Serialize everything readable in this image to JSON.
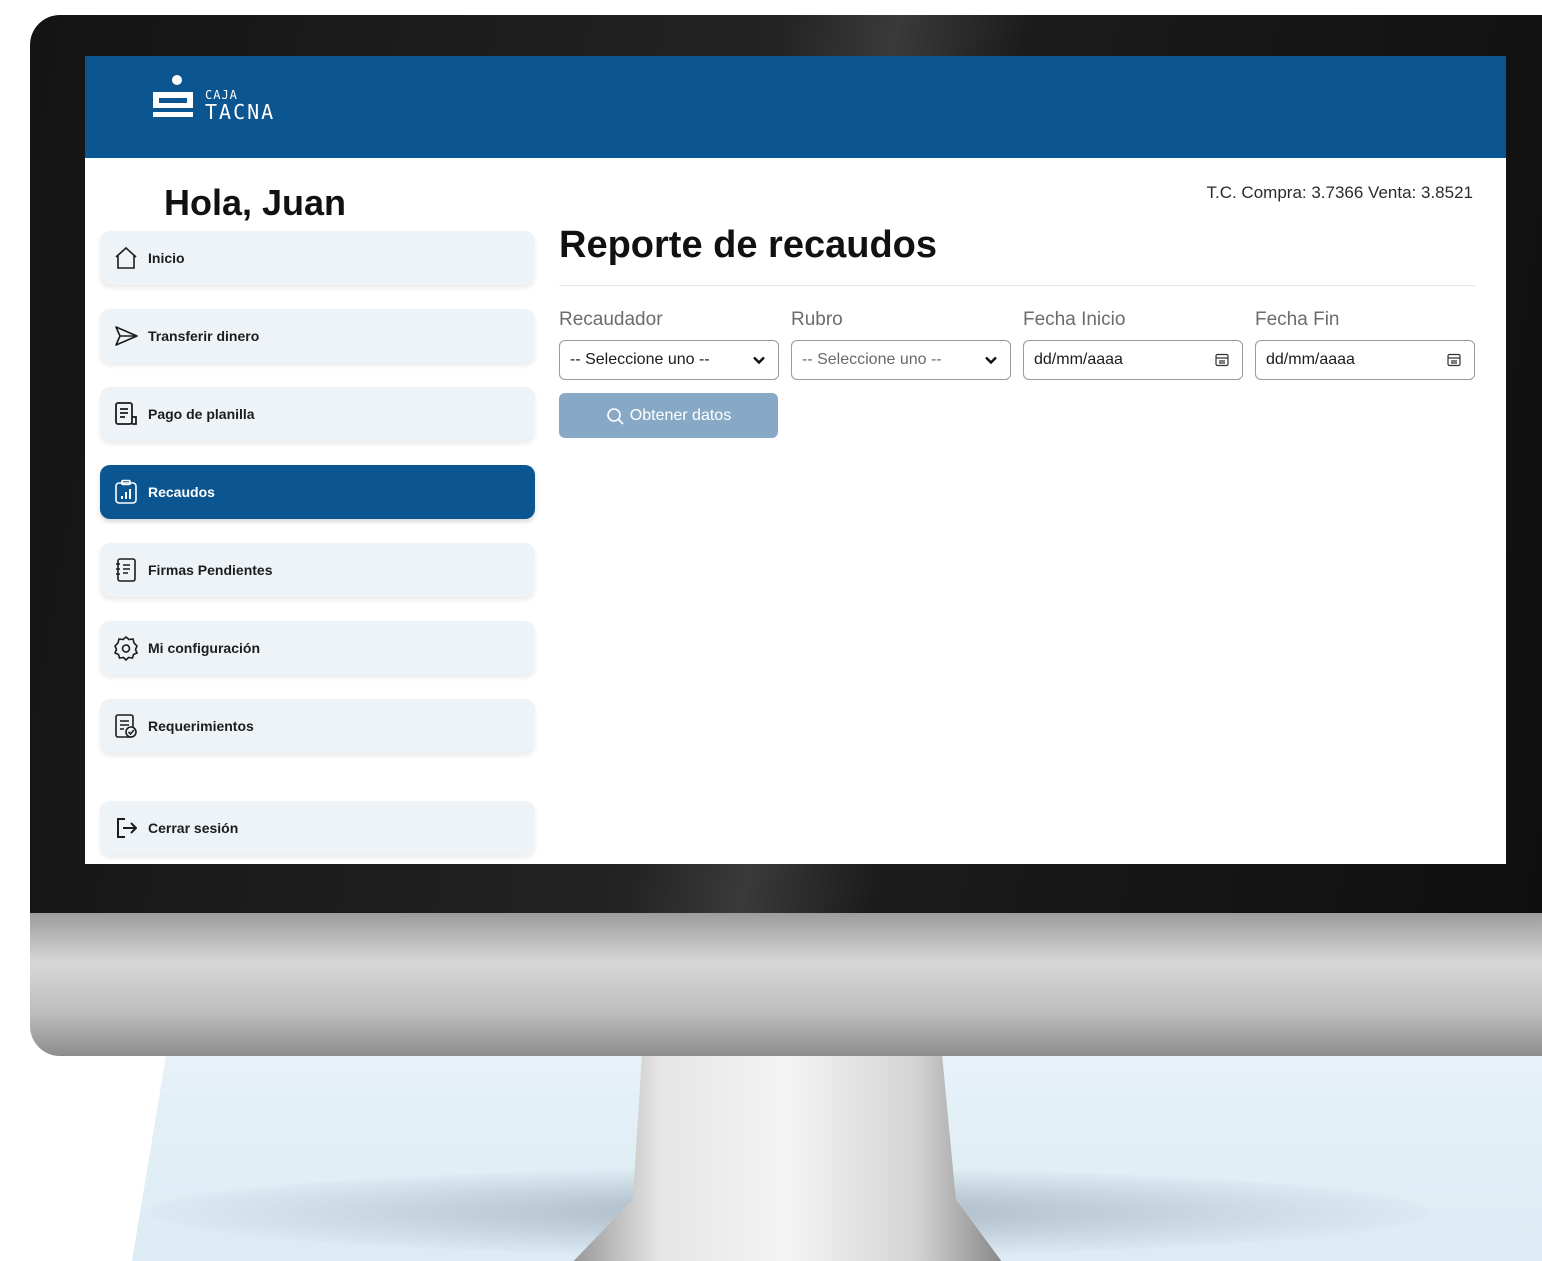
{
  "brand": {
    "logo_line1": "CAJA",
    "logo_line2": "TACNA",
    "primary_color": "#0b5590"
  },
  "greeting": "Hola, Juan",
  "exchange_rate": "T.C. Compra: 3.7366 Venta: 3.8521",
  "sidebar": {
    "items": [
      {
        "label": "Inicio",
        "icon": "home-icon",
        "active": false
      },
      {
        "label": "Transferir dinero",
        "icon": "send-icon",
        "active": false
      },
      {
        "label": "Pago de planilla",
        "icon": "payroll-document-icon",
        "active": false
      },
      {
        "label": "Recaudos",
        "icon": "report-chart-icon",
        "active": true
      },
      {
        "label": "Firmas Pendientes",
        "icon": "notebook-icon",
        "active": false
      },
      {
        "label": "Mi configuración",
        "icon": "gear-icon",
        "active": false
      },
      {
        "label": "Requerimientos",
        "icon": "checklist-document-icon",
        "active": false
      },
      {
        "label": "Cerrar sesión",
        "icon": "logout-icon",
        "active": false
      }
    ]
  },
  "main": {
    "title": "Reporte de recaudos",
    "filters": {
      "recaudador": {
        "label": "Recaudador",
        "value": "-- Seleccione uno --"
      },
      "rubro": {
        "label": "Rubro",
        "value": "-- Seleccione uno --"
      },
      "fecha_inicio": {
        "label": "Fecha Inicio",
        "value": "dd/mm/aaaa"
      },
      "fecha_fin": {
        "label": "Fecha Fin",
        "value": "dd/mm/aaaa"
      }
    },
    "submit_label": "Obtener datos"
  }
}
